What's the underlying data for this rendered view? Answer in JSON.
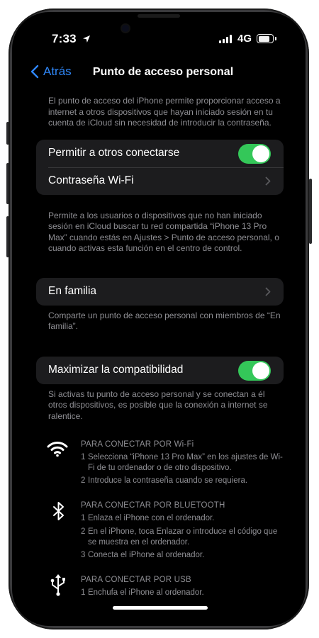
{
  "status_bar": {
    "time": "7:33",
    "network": "4G",
    "battery_percent": 80
  },
  "nav": {
    "back_label": "Atrás",
    "title": "Punto de acceso personal"
  },
  "intro_text": "El punto de acceso del iPhone permite proporcionar acceso a internet a otros dispositivos que hayan iniciado sesión en tu cuenta de iCloud sin necesidad de introducir la contraseña.",
  "group1": {
    "allow_label": "Permitir a otros conectarse",
    "allow_on": true,
    "wifi_password_label": "Contraseña Wi-Fi"
  },
  "share_text": "Permite a los usuarios o dispositivos que no han iniciado sesión en iCloud buscar tu red compartida “iPhone 13 Pro Max” cuando estás en Ajustes > Punto de acceso personal, o cuando activas esta función en el centro de control.",
  "family": {
    "label": "En familia",
    "footer": "Comparte un punto de acceso personal con miembros de “En familia”."
  },
  "compat": {
    "label": "Maximizar la compatibilidad",
    "on": true,
    "footer": "Si activas tu punto de acceso personal y se conectan a él otros dispositivos, es posible que la conexión a internet se ralentice."
  },
  "wifi_connect": {
    "icon": "wifi-icon",
    "heading": "PARA CONECTAR POR Wi-Fi",
    "steps": [
      {
        "num": "1",
        "text": "Selecciona “iPhone 13 Pro Max” en los ajustes de Wi-Fi de tu ordenador o de otro dispositivo."
      },
      {
        "num": "2",
        "text": "Introduce la contraseña cuando se requiera."
      }
    ]
  },
  "bt_connect": {
    "icon": "bluetooth-icon",
    "heading": "PARA CONECTAR POR BLUETOOTH",
    "steps": [
      {
        "num": "1",
        "text": "Enlaza el iPhone con el ordenador."
      },
      {
        "num": "2",
        "text": "En el iPhone, toca Enlazar o introduce el código que se muestra en el ordenador."
      },
      {
        "num": "3",
        "text": "Conecta el iPhone al ordenador."
      }
    ]
  },
  "usb_connect": {
    "icon": "usb-icon",
    "heading": "PARA CONECTAR POR USB",
    "steps": [
      {
        "num": "1",
        "text": "Enchufa el iPhone al ordenador."
      }
    ]
  },
  "colors": {
    "accent": "#2f86f6",
    "toggle_on": "#34c759",
    "cell_bg": "#1c1c1e",
    "footer_text": "#8e8e93"
  }
}
